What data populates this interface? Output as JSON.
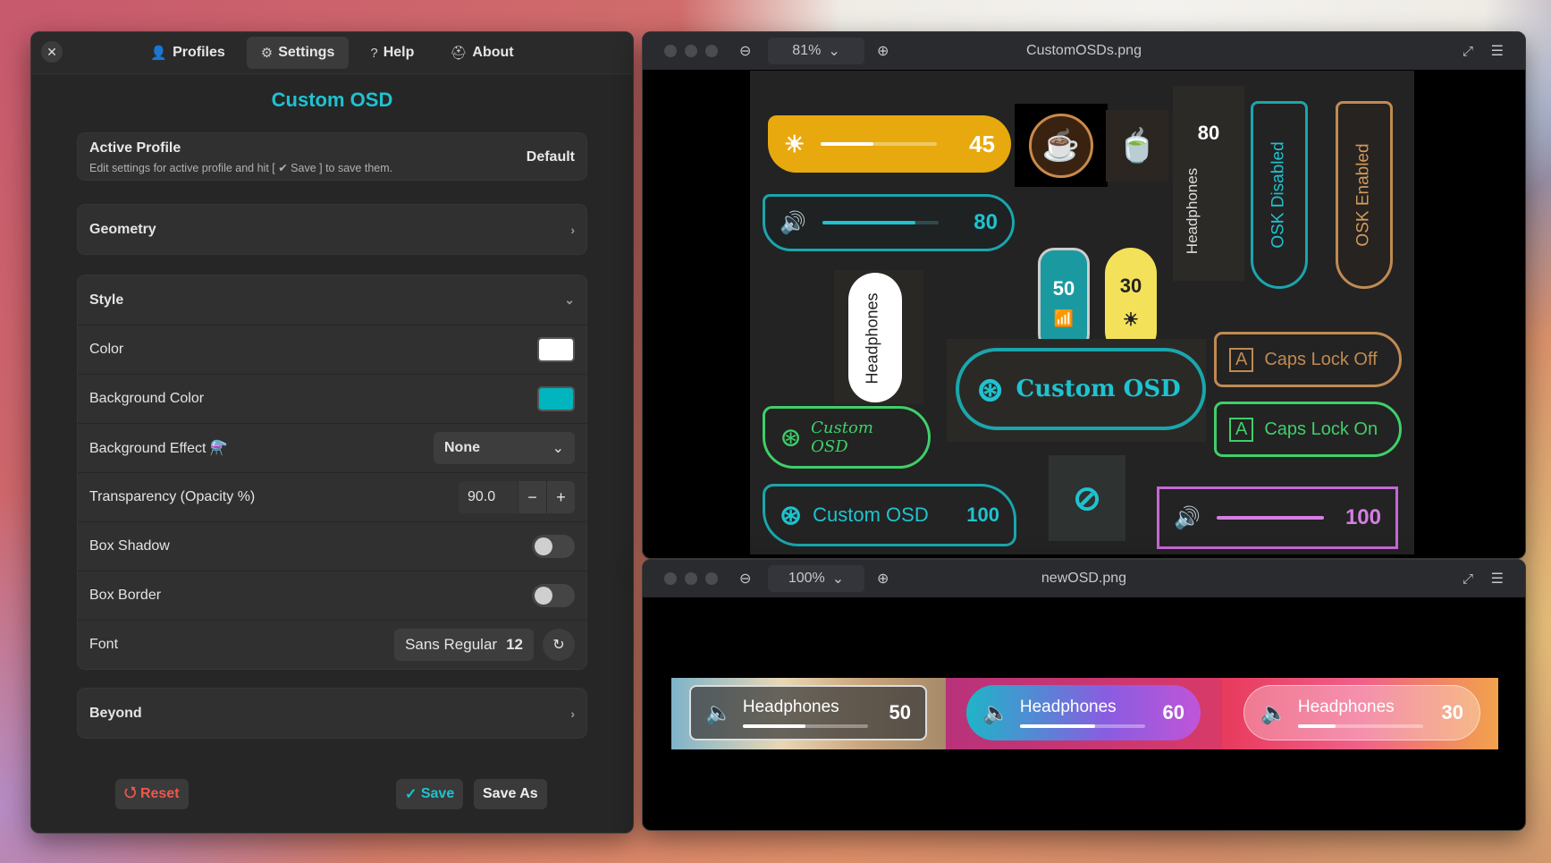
{
  "settings": {
    "close_icon": "close-icon",
    "tabs": [
      {
        "label": "Profiles",
        "icon": "👤"
      },
      {
        "label": "Settings",
        "icon": "⚙"
      },
      {
        "label": "Help",
        "icon": "?"
      },
      {
        "label": "About",
        "icon": "⛑"
      }
    ],
    "title": "Custom OSD",
    "active_profile": {
      "label": "Active Profile",
      "hint": "Edit settings for active profile and hit [ ✔ Save ] to save them.",
      "value": "Default"
    },
    "geometry": "Geometry",
    "style": {
      "header": "Style",
      "color": {
        "label": "Color",
        "value": "#ffffff"
      },
      "bg_color": {
        "label": "Background Color",
        "value": "#00b5bd"
      },
      "bg_effect": {
        "label": "Background Effect",
        "icon": "⚗️",
        "value": "None"
      },
      "transparency": {
        "label": "Transparency (Opacity %)",
        "value": "90.0",
        "minus": "−",
        "plus": "+"
      },
      "box_shadow": {
        "label": "Box Shadow"
      },
      "box_border": {
        "label": "Box Border"
      },
      "font": {
        "label": "Font",
        "name": "Sans Regular",
        "size": "12"
      }
    },
    "beyond": "Beyond",
    "buttons": {
      "reset": "Reset",
      "reset_icon": "⭯",
      "save": "Save",
      "save_icon": "✓",
      "save_as": "Save As"
    }
  },
  "viewer1": {
    "zoom": "81%",
    "filename": "CustomOSDs.png"
  },
  "viewer2": {
    "zoom": "100%",
    "filename": "newOSD.png"
  },
  "osd_samples": {
    "brightness": "45",
    "volume": "80",
    "headphones_top": "80",
    "headphones_label": "Headphones",
    "osk_disabled": "OSK Disabled",
    "osk_enabled": "OSK Enabled",
    "signal": "50",
    "bright2": "30",
    "custom_osd": "Custom OSD",
    "caps_off": "Caps Lock Off",
    "caps_on": "Caps Lock On",
    "custom_script": "Custom OSD",
    "custom_small": "Custom OSD",
    "custom_small_val": "100",
    "volume_purple": "100"
  },
  "new_osd": [
    {
      "label": "Headphones",
      "value": "50",
      "level": 0.5
    },
    {
      "label": "Headphones",
      "value": "60",
      "level": 0.6
    },
    {
      "label": "Headphones",
      "value": "30",
      "level": 0.3
    }
  ]
}
